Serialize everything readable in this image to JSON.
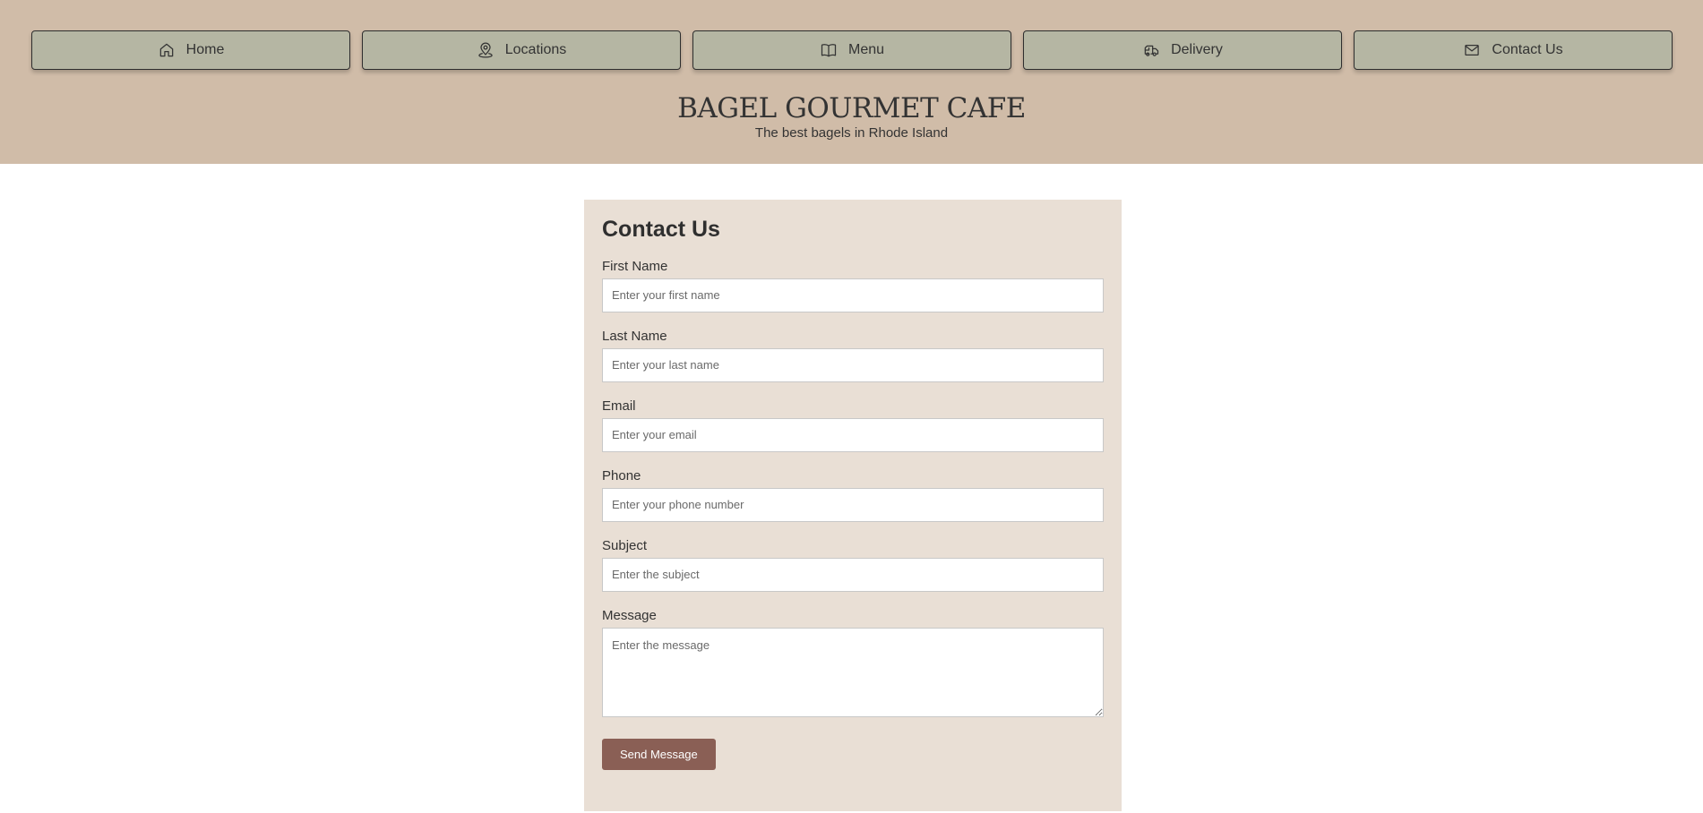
{
  "nav": {
    "items": [
      {
        "label": "Home",
        "icon": "home-icon"
      },
      {
        "label": "Locations",
        "icon": "map-pin-icon"
      },
      {
        "label": "Menu",
        "icon": "book-icon"
      },
      {
        "label": "Delivery",
        "icon": "truck-icon"
      },
      {
        "label": "Contact Us",
        "icon": "mail-icon"
      }
    ]
  },
  "brand": {
    "title": "BAGEL GOURMET CAFE",
    "tagline": "The best bagels in Rhode Island"
  },
  "form": {
    "title": "Contact Us",
    "fields": {
      "first_name": {
        "label": "First Name",
        "placeholder": "Enter your first name",
        "value": ""
      },
      "last_name": {
        "label": "Last Name",
        "placeholder": "Enter your last name",
        "value": ""
      },
      "email": {
        "label": "Email",
        "placeholder": "Enter your email",
        "value": ""
      },
      "phone": {
        "label": "Phone",
        "placeholder": "Enter your phone number",
        "value": ""
      },
      "subject": {
        "label": "Subject",
        "placeholder": "Enter the subject",
        "value": ""
      },
      "message": {
        "label": "Message",
        "placeholder": "Enter the message",
        "value": ""
      }
    },
    "submit_label": "Send Message"
  },
  "colors": {
    "header_bg": "#d0bca8",
    "nav_button_bg": "#b5b6a3",
    "card_bg": "#e9dfd5",
    "submit_bg": "#8a5f55"
  }
}
